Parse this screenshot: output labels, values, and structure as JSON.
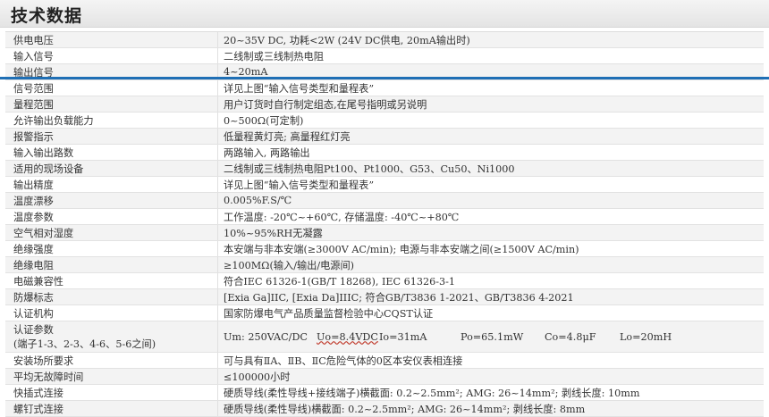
{
  "title": "技术数据",
  "rows": [
    {
      "label": "供电电压",
      "value": "20~35V DC, 功耗<2W (24V DC供电, 20mA输出时)"
    },
    {
      "label": "输入信号",
      "value": "二线制或三线制热电阻"
    },
    {
      "label": "输出信号",
      "value": "4~20mA"
    },
    {
      "label": "信号范围",
      "value": "详见上图“输入信号类型和量程表”"
    },
    {
      "label": "量程范围",
      "value": "用户订货时自行制定组态,在尾号指明或另说明"
    },
    {
      "label": "允许输出负载能力",
      "value": "0~500Ω(可定制)"
    },
    {
      "label": "报警指示",
      "value": "低量程黄灯亮; 高量程红灯亮"
    },
    {
      "label": "输入输出路数",
      "value": "两路输入, 两路输出"
    },
    {
      "label": "适用的现场设备",
      "value": "二线制或三线制热电阻Pt100、Pt1000、G53、Cu50、Ni1000"
    },
    {
      "label": "输出精度",
      "value": "详见上图“输入信号类型和量程表”"
    },
    {
      "label": "温度漂移",
      "value": "0.005%F.S/℃"
    },
    {
      "label": "温度参数",
      "value": "工作温度: -20℃~+60℃, 存储温度: -40℃~+80℃"
    },
    {
      "label": "空气相对湿度",
      "value": "10%~95%RH无凝露"
    },
    {
      "label": "绝缘强度",
      "value": "本安端与非本安端(≥3000V AC/min); 电源与非本安端之间(≥1500V AC/min)"
    },
    {
      "label": "绝缘电阻",
      "value": "≥100MΩ(输入/输出/电源间)"
    },
    {
      "label": "电磁兼容性",
      "value": "符合IEC 61326-1(GB/T 18268), IEC 61326-3-1"
    },
    {
      "label": "防爆标志",
      "value": "[Exia Ga]IIC, [Exia Da]IIIC; 符合GB/T3836 1-2021、GB/T3836 4-2021"
    },
    {
      "label": "认证机构",
      "value": "国家防爆电气产品质量监督检验中心CQST认证"
    }
  ],
  "cert": {
    "label": "认证参数",
    "sublabel": "(端子1-3、2-3、4-6、5-6之间)",
    "um": "Um: 250VAC/DC",
    "uo": "Uo=8.4VDC",
    "io": "Io=31mA",
    "po": "Po=65.1mW",
    "co": "Co=4.8μF",
    "lo": "Lo=20mH"
  },
  "rows2": [
    {
      "label": "安装场所要求",
      "value": "可与具有ⅡA、ⅡB、ⅡC危险气体的0区本安仪表相连接"
    },
    {
      "label": "平均无故障时间",
      "value": "≤100000小时"
    },
    {
      "label": "快插式连接",
      "value": "硬质导线(柔性导线+接线端子)横截面: 0.2~2.5mm²; AMG: 26~14mm²; 剥线长度: 10mm"
    },
    {
      "label": "螺钉式连接",
      "value": "硬质导线(柔性导线)横截面: 0.2~2.5mm²; AMG: 26~14mm²; 剥线长度: 8mm"
    }
  ]
}
